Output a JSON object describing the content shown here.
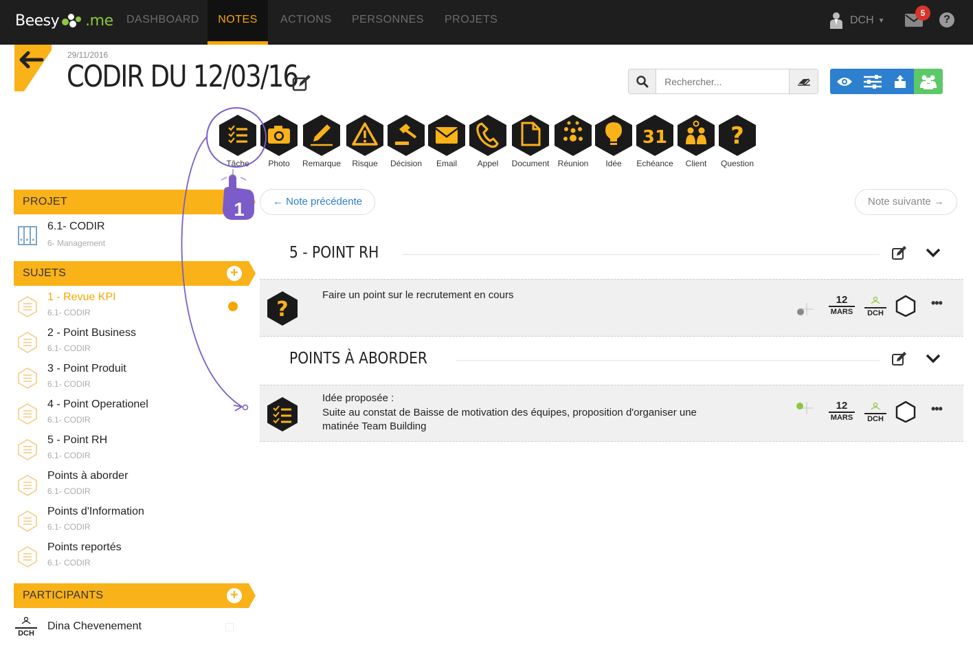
{
  "app": {
    "logo_text_a": "Beesy",
    "logo_text_b": ".me"
  },
  "nav": {
    "tabs": [
      {
        "label": "DASHBOARD",
        "active": false
      },
      {
        "label": "NOTES",
        "active": true
      },
      {
        "label": "ACTIONS",
        "active": false
      },
      {
        "label": "PERSONNES",
        "active": false
      },
      {
        "label": "PROJETS",
        "active": false
      }
    ],
    "user_label": "DCH",
    "mail_count": "5"
  },
  "header": {
    "date": "29/11/2016",
    "title": "CODIR DU 12/03/16"
  },
  "search": {
    "placeholder": "Rechercher..."
  },
  "note_types": [
    {
      "label": "Tâche",
      "icon": "task-list-icon"
    },
    {
      "label": "Photo",
      "icon": "camera-icon"
    },
    {
      "label": "Remarque",
      "icon": "pen-icon"
    },
    {
      "label": "Risque",
      "icon": "warning-icon"
    },
    {
      "label": "Décision",
      "icon": "gavel-icon"
    },
    {
      "label": "Email",
      "icon": "envelope-icon"
    },
    {
      "label": "Appel",
      "icon": "phone-icon"
    },
    {
      "label": "Document",
      "icon": "document-icon"
    },
    {
      "label": "Réunion",
      "icon": "meeting-icon"
    },
    {
      "label": "Idée",
      "icon": "lightbulb-icon"
    },
    {
      "label": "Echéance",
      "icon": "calendar-31-icon"
    },
    {
      "label": "Client",
      "icon": "client-group-icon"
    },
    {
      "label": "Question",
      "icon": "question-icon"
    }
  ],
  "tutorial": {
    "step_number": "1"
  },
  "sidebar": {
    "projet_header": "PROJET",
    "projet": {
      "name": "6.1- CODIR",
      "sub": "6- Management"
    },
    "sujets_header": "SUJETS",
    "sujets": [
      {
        "name": "1 - Revue KPI",
        "sub": "6.1- CODIR",
        "active": true
      },
      {
        "name": "2 - Point Business",
        "sub": "6.1- CODIR",
        "active": false
      },
      {
        "name": "3 - Point Produit",
        "sub": "6.1- CODIR",
        "active": false
      },
      {
        "name": "4 - Point Operationel",
        "sub": "6.1- CODIR",
        "active": false
      },
      {
        "name": "5 - Point RH",
        "sub": "6.1- CODIR",
        "active": false
      },
      {
        "name": "Points à aborder",
        "sub": "6.1- CODIR",
        "active": false
      },
      {
        "name": "Points d'Information",
        "sub": "6.1- CODIR",
        "active": false
      },
      {
        "name": "Points reportés",
        "sub": "6.1- CODIR",
        "active": false
      }
    ],
    "participants_header": "PARTICIPANTS",
    "participants": [
      {
        "initials": "DCH",
        "name": "Dina Chevenement"
      }
    ]
  },
  "main": {
    "prev_note": "← Note précédente",
    "next_note": "Note suivante →",
    "sections": [
      {
        "title": "5 - POINT RH",
        "note": {
          "type_icon": "question-icon",
          "lines": [
            "Faire un point sur le recrutement en cours"
          ],
          "day": "12",
          "month": "MARS",
          "owner": "DCH"
        }
      },
      {
        "title": "POINTS À ABORDER",
        "note": {
          "type_icon": "task-list-icon",
          "lines": [
            "Idée proposée :",
            "Suite au constat de Baisse de motivation des équipes, proposition d'organiser une",
            "matinée Team Building"
          ],
          "day": "12",
          "month": "MARS",
          "owner": "DCH"
        }
      }
    ]
  },
  "colors": {
    "accent": "#f7a600",
    "sidebar_header": "#fab219",
    "nav_bg": "#1e1e1e",
    "blue_button": "#2d7fd0",
    "green_button": "#5cc86a",
    "tutorial_purple": "#7b5cc8"
  }
}
